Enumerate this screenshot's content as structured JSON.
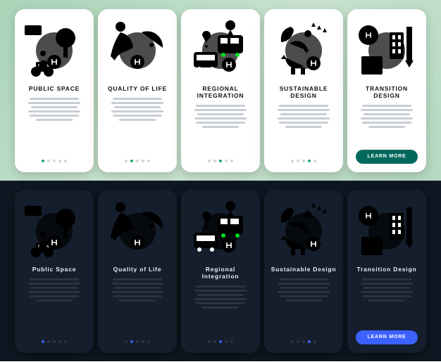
{
  "button_label": "LEARN MORE",
  "light": {
    "accent": "#1ca85a",
    "cards": [
      {
        "id": "public-space",
        "title": "PUBLIC SPACE",
        "icon": "park",
        "active": 0
      },
      {
        "id": "quality-of-life",
        "title": "QUALITY OF LIFE",
        "icon": "vitality",
        "active": 1
      },
      {
        "id": "regional-integration",
        "title": "REGIONAL INTEGRATION",
        "icon": "transit",
        "active": 2
      },
      {
        "id": "sustainable-design",
        "title": "SUSTAINABLE DESIGN",
        "icon": "eco",
        "active": 3
      },
      {
        "id": "transition-design",
        "title": "TRANSITION DESIGN",
        "icon": "blueprint",
        "active": 4
      }
    ]
  },
  "dark": {
    "accent": "#3c61ff",
    "cards": [
      {
        "id": "public-space",
        "title": "Public Space",
        "icon": "park",
        "active": 0
      },
      {
        "id": "quality-of-life",
        "title": "Quality of Life",
        "icon": "vitality",
        "active": 1
      },
      {
        "id": "regional-integration",
        "title": "Regional Integration",
        "icon": "transit",
        "active": 2
      },
      {
        "id": "sustainable-design",
        "title": "Sustainable Design",
        "icon": "eco",
        "active": 3
      },
      {
        "id": "transition-design",
        "title": "Transition Design",
        "icon": "blueprint",
        "active": 4
      }
    ]
  }
}
